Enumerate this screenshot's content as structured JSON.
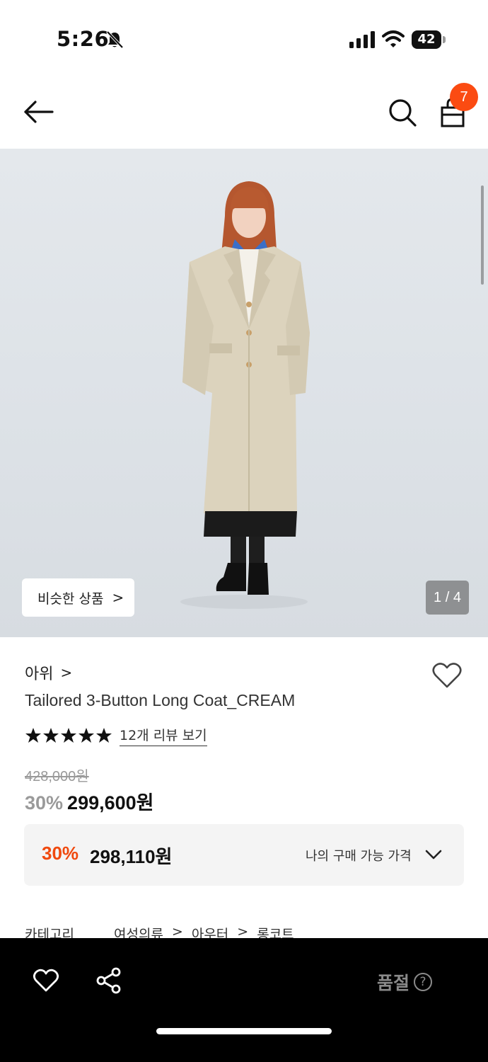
{
  "status_bar": {
    "time": "5:26",
    "battery": "42"
  },
  "nav": {
    "cart_count": "7"
  },
  "hero": {
    "similar_label": "비슷한 상품",
    "similar_chevron": ">",
    "page_indicator": "1 / 4"
  },
  "product": {
    "brand": "아위",
    "brand_chevron": ">",
    "title": "Tailored 3-Button Long Coat_CREAM",
    "rating": 5,
    "review_link": "12개 리뷰 보기",
    "original_price": "428,000원",
    "discount_rate": "30%",
    "sale_price": "299,600원"
  },
  "my_price": {
    "discount_rate": "30%",
    "price": "298,110원",
    "label": "나의 구매 가능 가격"
  },
  "category": {
    "label": "카테고리",
    "path": [
      "여성의류",
      ">",
      "아우터",
      ">",
      "롱코트"
    ]
  },
  "bottom_bar": {
    "soldout_label": "품절",
    "help_glyph": "?"
  },
  "colors": {
    "accent": "#fb4b12",
    "discount_orange": "#f0490e",
    "bottom_bar_bg": "#000000"
  }
}
